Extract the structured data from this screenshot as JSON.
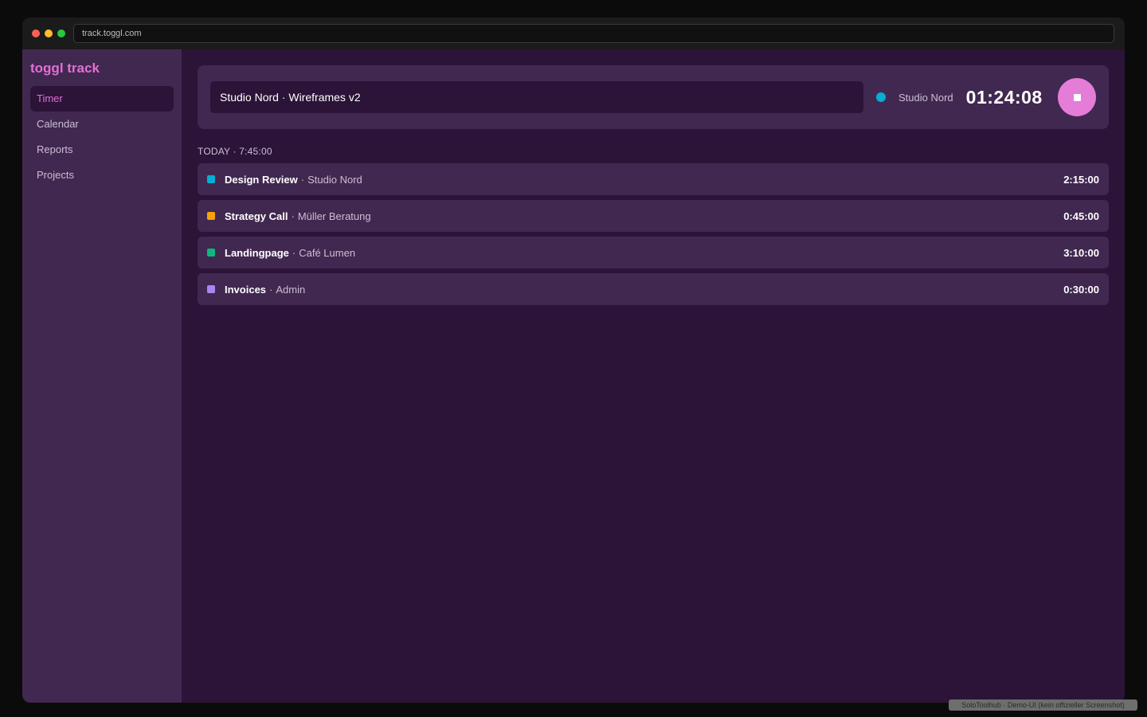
{
  "browser": {
    "url": "track.toggl.com",
    "traffic_lights": [
      "#ff5f57",
      "#febc2e",
      "#28c840"
    ]
  },
  "sidebar": {
    "brand": "toggl track",
    "items": [
      {
        "label": "Timer",
        "active": true
      },
      {
        "label": "Calendar",
        "active": false
      },
      {
        "label": "Reports",
        "active": false
      },
      {
        "label": "Projects",
        "active": false
      }
    ]
  },
  "timer": {
    "description": "Studio Nord · Wireframes v2",
    "project": "Studio Nord",
    "project_color": "#06aed5",
    "elapsed": "01:24:08",
    "stop_icon": "stop-icon",
    "stop_color": "#e57cd8"
  },
  "today": {
    "header": "TODAY · 7:45:00",
    "entries": [
      {
        "title": "Design Review",
        "client": "Studio Nord",
        "duration": "2:15:00",
        "color": "#06aed5"
      },
      {
        "title": "Strategy Call",
        "client": "Müller Beratung",
        "duration": "0:45:00",
        "color": "#f5a20d"
      },
      {
        "title": "Landingpage",
        "client": "Café Lumen",
        "duration": "3:10:00",
        "color": "#0fb67d"
      },
      {
        "title": "Invoices",
        "client": "Admin",
        "duration": "0:30:00",
        "color": "#a985f2"
      }
    ]
  },
  "footer": {
    "watermark": "SoloToolhub · Demo-UI (kein offizieller Screenshot)"
  },
  "colors": {
    "accent": "#e36fd4",
    "sidebar_bg": "#412850",
    "main_bg": "#2b1438"
  }
}
